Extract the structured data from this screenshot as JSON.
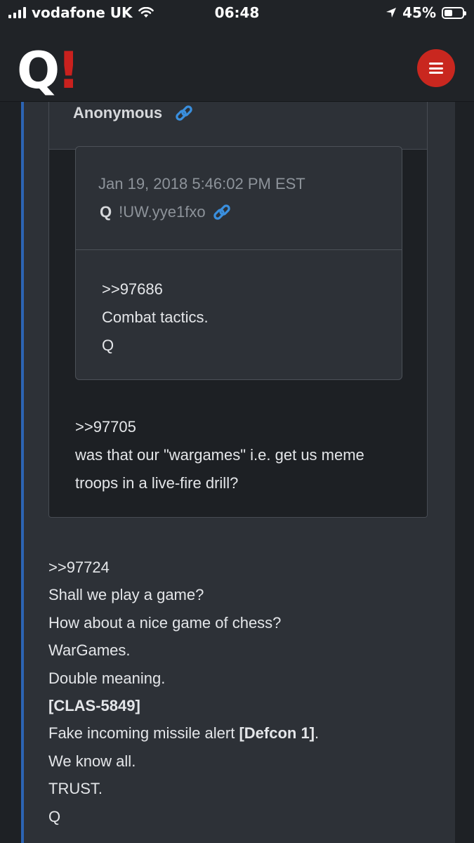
{
  "status_bar": {
    "carrier": "vodafone UK",
    "time": "06:48",
    "battery_percent": "45%",
    "battery_level": 0.45
  },
  "header": {
    "logo_letter": "Q",
    "logo_mark": "!",
    "brand_color": "#c9211e"
  },
  "post": {
    "quoted_post": {
      "author": "Anonymous",
      "nested_quote": {
        "date": "Jan 19, 2018 5:46:02 PM EST",
        "author_name": "Q",
        "tripcode": "!UW.yye1fxo",
        "lines": [
          ">>97686",
          "Combat tactics.",
          "Q"
        ]
      },
      "lines": [
        ">>97705",
        "was that our \"wargames\" i.e. get us meme",
        "troops in a live-fire drill?"
      ]
    },
    "body": {
      "line1": ">>97724",
      "line2": "Shall we play a game?",
      "line3": "How about a nice game of chess?",
      "line4": "WarGames.",
      "line5": "Double meaning.",
      "line6": "[CLAS-5849]",
      "line7_prefix": "Fake incoming missile alert ",
      "line7_bold": "[Defcon 1]",
      "line7_suffix": ".",
      "line8": "We know all.",
      "line9": "TRUST.",
      "line10": "Q"
    }
  },
  "icons": {
    "link": "link-icon",
    "menu": "hamburger-icon",
    "location": "location-arrow-icon",
    "wifi": "wifi-icon"
  },
  "colors": {
    "accent_rail": "#2c64b3",
    "link_blue": "#3a8fde",
    "menu_red": "#c9271f"
  }
}
